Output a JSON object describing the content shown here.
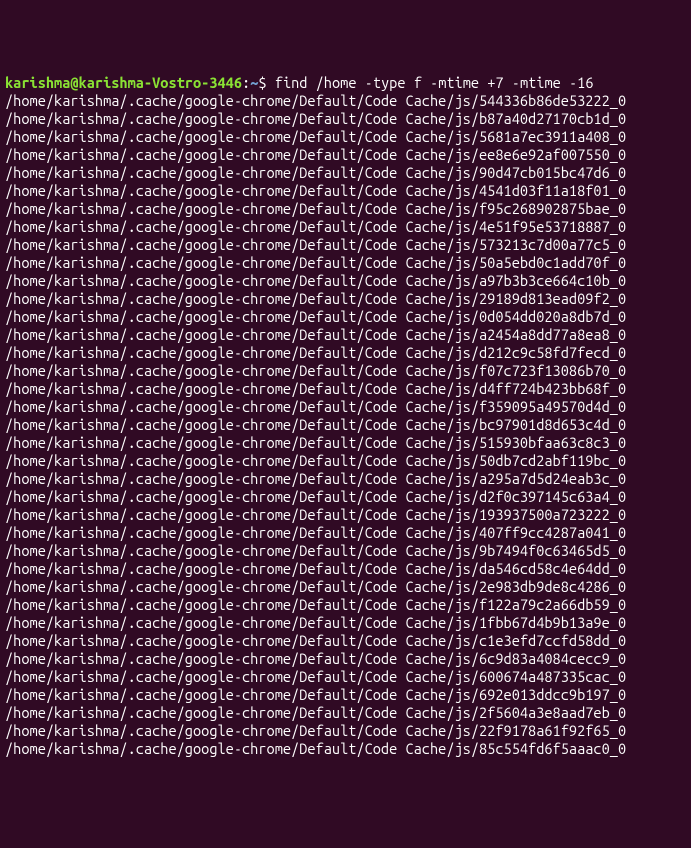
{
  "prompt": {
    "user": "karishma@karishma-Vostro-3446",
    "colon": ":",
    "tilde": "~",
    "dollar": "$",
    "command": "find /home -type f -mtime +7 -mtime -16"
  },
  "output": [
    "/home/karishma/.cache/google-chrome/Default/Code Cache/js/544336b86de53222_0",
    "/home/karishma/.cache/google-chrome/Default/Code Cache/js/b87a40d27170cb1d_0",
    "/home/karishma/.cache/google-chrome/Default/Code Cache/js/5681a7ec3911a408_0",
    "/home/karishma/.cache/google-chrome/Default/Code Cache/js/ee8e6e92af007550_0",
    "/home/karishma/.cache/google-chrome/Default/Code Cache/js/90d47cb015bc47d6_0",
    "/home/karishma/.cache/google-chrome/Default/Code Cache/js/4541d03f11a18f01_0",
    "/home/karishma/.cache/google-chrome/Default/Code Cache/js/f95c268902875bae_0",
    "/home/karishma/.cache/google-chrome/Default/Code Cache/js/4e51f95e53718887_0",
    "/home/karishma/.cache/google-chrome/Default/Code Cache/js/573213c7d00a77c5_0",
    "/home/karishma/.cache/google-chrome/Default/Code Cache/js/50a5ebd0c1add70f_0",
    "/home/karishma/.cache/google-chrome/Default/Code Cache/js/a97b3b3ce664c10b_0",
    "/home/karishma/.cache/google-chrome/Default/Code Cache/js/29189d813ead09f2_0",
    "/home/karishma/.cache/google-chrome/Default/Code Cache/js/0d054dd020a8db7d_0",
    "/home/karishma/.cache/google-chrome/Default/Code Cache/js/a2454a8dd77a8ea8_0",
    "/home/karishma/.cache/google-chrome/Default/Code Cache/js/d212c9c58fd7fecd_0",
    "/home/karishma/.cache/google-chrome/Default/Code Cache/js/f07c723f13086b70_0",
    "/home/karishma/.cache/google-chrome/Default/Code Cache/js/d4ff724b423bb68f_0",
    "/home/karishma/.cache/google-chrome/Default/Code Cache/js/f359095a49570d4d_0",
    "/home/karishma/.cache/google-chrome/Default/Code Cache/js/bc97901d8d653c4d_0",
    "/home/karishma/.cache/google-chrome/Default/Code Cache/js/515930bfaa63c8c3_0",
    "/home/karishma/.cache/google-chrome/Default/Code Cache/js/50db7cd2abf119bc_0",
    "/home/karishma/.cache/google-chrome/Default/Code Cache/js/a295a7d5d24eab3c_0",
    "/home/karishma/.cache/google-chrome/Default/Code Cache/js/d2f0c397145c63a4_0",
    "/home/karishma/.cache/google-chrome/Default/Code Cache/js/193937500a723222_0",
    "/home/karishma/.cache/google-chrome/Default/Code Cache/js/407ff9cc4287a041_0",
    "/home/karishma/.cache/google-chrome/Default/Code Cache/js/9b7494f0c63465d5_0",
    "/home/karishma/.cache/google-chrome/Default/Code Cache/js/da546cd58c4e64dd_0",
    "/home/karishma/.cache/google-chrome/Default/Code Cache/js/2e983db9de8c4286_0",
    "/home/karishma/.cache/google-chrome/Default/Code Cache/js/f122a79c2a66db59_0",
    "/home/karishma/.cache/google-chrome/Default/Code Cache/js/1fbb67d4b9b13a9e_0",
    "/home/karishma/.cache/google-chrome/Default/Code Cache/js/c1e3efd7ccfd58dd_0",
    "/home/karishma/.cache/google-chrome/Default/Code Cache/js/6c9d83a4084cecc9_0",
    "/home/karishma/.cache/google-chrome/Default/Code Cache/js/600674a487335cac_0",
    "/home/karishma/.cache/google-chrome/Default/Code Cache/js/692e013ddcc9b197_0",
    "/home/karishma/.cache/google-chrome/Default/Code Cache/js/2f5604a3e8aad7eb_0",
    "/home/karishma/.cache/google-chrome/Default/Code Cache/js/22f9178a61f92f65_0",
    "/home/karishma/.cache/google-chrome/Default/Code Cache/js/85c554fd6f5aaac0_0"
  ]
}
